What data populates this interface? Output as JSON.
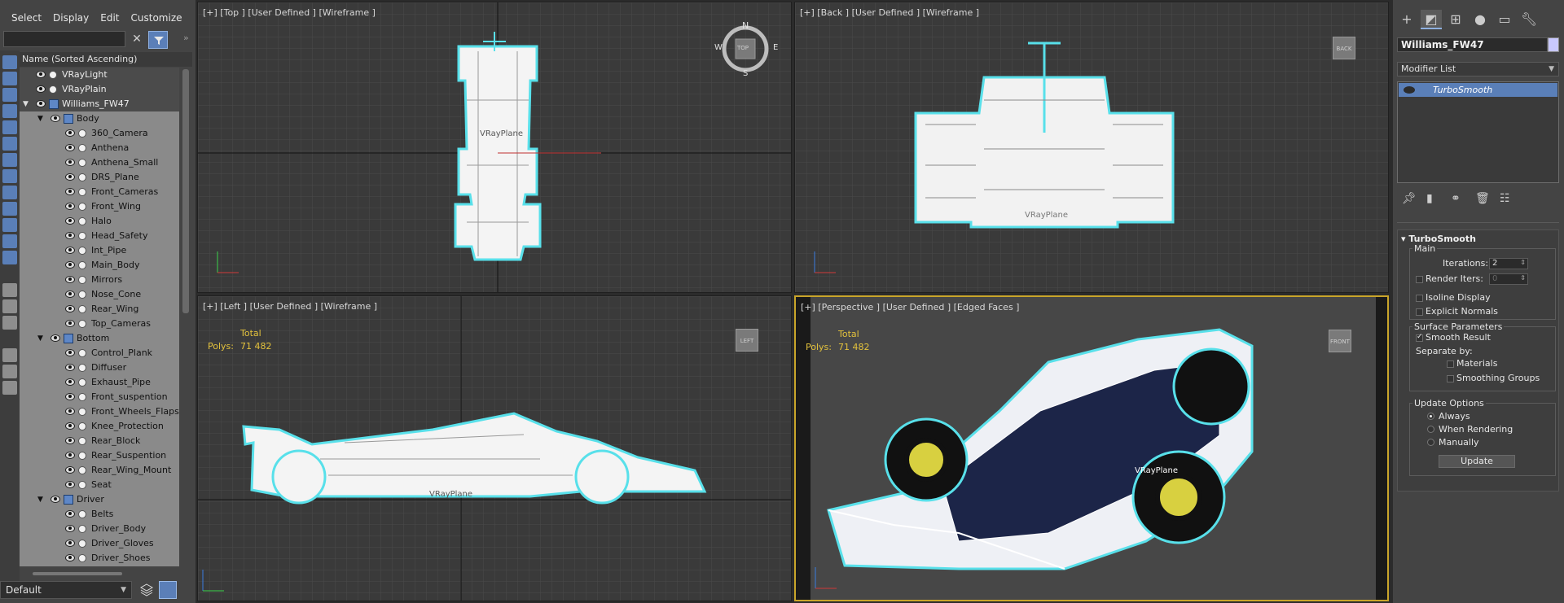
{
  "menu": {
    "select": "Select",
    "display": "Display",
    "edit": "Edit",
    "customize": "Customize"
  },
  "explorer": {
    "column_header": "Name (Sorted Ascending)",
    "tree": [
      {
        "label": "VRayLight",
        "level": 0,
        "kind": "light",
        "top": true
      },
      {
        "label": "VRayPlain",
        "level": 0,
        "kind": "obj",
        "top": true
      },
      {
        "label": "Williams_FW47",
        "level": 0,
        "kind": "group",
        "expanded": true,
        "top": true
      },
      {
        "label": "Body",
        "level": 1,
        "kind": "group",
        "expanded": true
      },
      {
        "label": "360_Camera",
        "level": 2,
        "kind": "obj"
      },
      {
        "label": "Anthena",
        "level": 2,
        "kind": "obj"
      },
      {
        "label": "Anthena_Small",
        "level": 2,
        "kind": "obj"
      },
      {
        "label": "DRS_Plane",
        "level": 2,
        "kind": "obj"
      },
      {
        "label": "Front_Cameras",
        "level": 2,
        "kind": "obj"
      },
      {
        "label": "Front_Wing",
        "level": 2,
        "kind": "obj"
      },
      {
        "label": "Halo",
        "level": 2,
        "kind": "obj"
      },
      {
        "label": "Head_Safety",
        "level": 2,
        "kind": "obj"
      },
      {
        "label": "Int_Pipe",
        "level": 2,
        "kind": "obj"
      },
      {
        "label": "Main_Body",
        "level": 2,
        "kind": "obj"
      },
      {
        "label": "Mirrors",
        "level": 2,
        "kind": "obj"
      },
      {
        "label": "Nose_Cone",
        "level": 2,
        "kind": "obj"
      },
      {
        "label": "Rear_Wing",
        "level": 2,
        "kind": "obj"
      },
      {
        "label": "Top_Cameras",
        "level": 2,
        "kind": "obj"
      },
      {
        "label": "Bottom",
        "level": 1,
        "kind": "group",
        "expanded": true
      },
      {
        "label": "Control_Plank",
        "level": 2,
        "kind": "obj"
      },
      {
        "label": "Diffuser",
        "level": 2,
        "kind": "obj"
      },
      {
        "label": "Exhaust_Pipe",
        "level": 2,
        "kind": "obj"
      },
      {
        "label": "Front_suspention",
        "level": 2,
        "kind": "obj"
      },
      {
        "label": "Front_Wheels_Flaps",
        "level": 2,
        "kind": "obj"
      },
      {
        "label": "Knee_Protection",
        "level": 2,
        "kind": "obj"
      },
      {
        "label": "Rear_Block",
        "level": 2,
        "kind": "obj"
      },
      {
        "label": "Rear_Suspention",
        "level": 2,
        "kind": "obj"
      },
      {
        "label": "Rear_Wing_Mount",
        "level": 2,
        "kind": "obj"
      },
      {
        "label": "Seat",
        "level": 2,
        "kind": "obj"
      },
      {
        "label": "Driver",
        "level": 1,
        "kind": "group",
        "expanded": true
      },
      {
        "label": "Belts",
        "level": 2,
        "kind": "obj"
      },
      {
        "label": "Driver_Body",
        "level": 2,
        "kind": "obj"
      },
      {
        "label": "Driver_Gloves",
        "level": 2,
        "kind": "obj"
      },
      {
        "label": "Driver_Shoes",
        "level": 2,
        "kind": "obj"
      }
    ],
    "layer": "Default"
  },
  "viewports": {
    "top": {
      "label": "[+] [Top ] [User Defined ] [Wireframe ]",
      "compass": {
        "n": "N",
        "s": "S",
        "e": "E",
        "w": "W"
      },
      "cube": "TOP",
      "ground": "VRayPlane"
    },
    "back": {
      "label": "[+] [Back ] [User Defined ] [Wireframe ]",
      "cube": "BACK",
      "ground": "VRayPlane"
    },
    "left": {
      "label": "[+] [Left ] [User Defined ] [Wireframe ]",
      "cube": "LEFT",
      "ground": "VRayPlane",
      "stats_total": "Total",
      "stats_polys_label": "Polys:",
      "stats_polys_value": "71 482"
    },
    "persp": {
      "label": "[+] [Perspective ] [User Defined ] [Edged Faces ]",
      "cube": "FRONT",
      "ground": "VRayPlane",
      "stats_total": "Total",
      "stats_polys_label": "Polys:",
      "stats_polys_value": "71 482"
    }
  },
  "command_panel": {
    "object_name": "Williams_FW47",
    "modifier_list": "Modifier List",
    "stack_item": "TurboSmooth",
    "rollout_title": "TurboSmooth",
    "main_label": "Main",
    "iterations_label": "Iterations:",
    "iterations_value": "2",
    "render_iters_label": "Render Iters:",
    "render_iters_value": "0",
    "isoline_label": "Isoline Display",
    "explicit_label": "Explicit Normals",
    "surface_params_label": "Surface Parameters",
    "smooth_result_label": "Smooth Result",
    "separate_by_label": "Separate by:",
    "materials_label": "Materials",
    "smoothing_groups_label": "Smoothing Groups",
    "update_options_label": "Update Options",
    "always_label": "Always",
    "when_rendering_label": "When Rendering",
    "manually_label": "Manually",
    "update_button": "Update"
  },
  "colors": {
    "accent": "#5a7fb8",
    "selection_outline": "#58e0ea",
    "stats": "#e3c23c",
    "active_viewport": "#c9a52a"
  }
}
